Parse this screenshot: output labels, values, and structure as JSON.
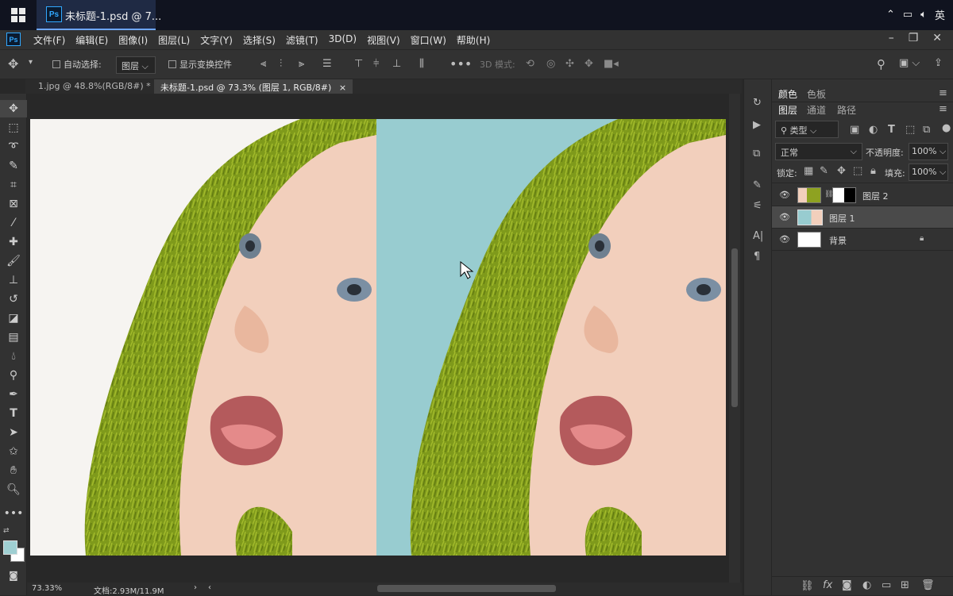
{
  "taskbar": {
    "app_title": "未标题-1.psd @ 7...",
    "ps_badge": "Ps",
    "ime_label": "英",
    "tray_icons": [
      "chevron-up-icon",
      "network-icon",
      "volume-icon"
    ]
  },
  "menubar": {
    "ps_badge": "Ps",
    "items": [
      "文件(F)",
      "编辑(E)",
      "图像(I)",
      "图层(L)",
      "文字(Y)",
      "选择(S)",
      "滤镜(T)",
      "3D(D)",
      "视图(V)",
      "窗口(W)",
      "帮助(H)"
    ],
    "window_controls": [
      "minimize-icon",
      "restore-icon",
      "close-icon"
    ]
  },
  "options_bar": {
    "auto_select_label": "自动选择:",
    "auto_select_value": "图层",
    "show_transform_label": "显示变换控件",
    "mode_3d_label": "3D 模式:"
  },
  "tabs": [
    {
      "label": "1.jpg @ 48.8%(RGB/8#) *",
      "active": false
    },
    {
      "label": "未标题-1.psd @ 73.3% (图层 1, RGB/8#)",
      "active": true
    }
  ],
  "tab_close_glyph": "×",
  "status": {
    "zoom": "73.33%",
    "doc_info": "文档:2.93M/11.9M"
  },
  "colors": {
    "foreground": "#9fcfd2",
    "background": "#ffffff",
    "fill_teal": "#98ccd0",
    "hood_green": "#7f9a1b",
    "skin": "#f2cfbc"
  },
  "panels": {
    "color_tab": "颜色",
    "swatch_tab": "色板",
    "layers_tab": "图层",
    "channels_tab": "通道",
    "paths_tab": "路径",
    "filter_kind": "类型",
    "blend_mode": "正常",
    "opacity_label": "不透明度:",
    "opacity_value": "100%",
    "lock_label": "锁定:",
    "fill_label": "填充:",
    "fill_value": "100%"
  },
  "layers": [
    {
      "name": "图层 2",
      "selected": false,
      "has_mask": true
    },
    {
      "name": "图层 1",
      "selected": true,
      "has_mask": false
    },
    {
      "name": "背景",
      "selected": false,
      "locked": true
    }
  ]
}
